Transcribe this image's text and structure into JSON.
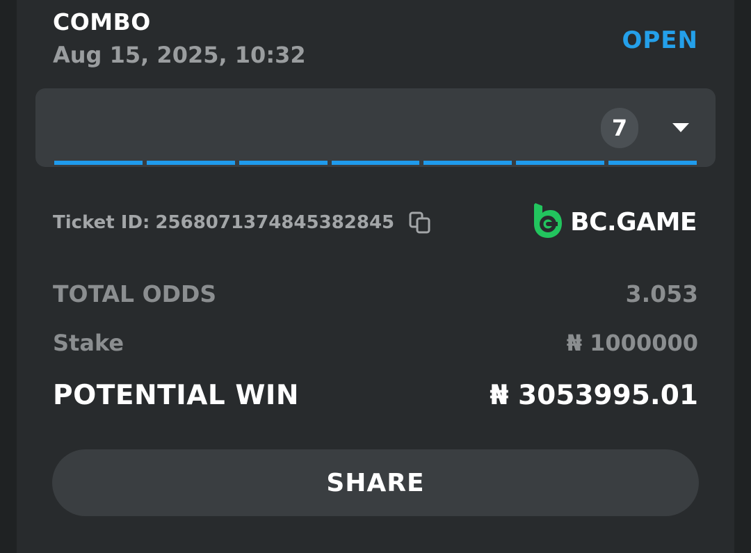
{
  "bet": {
    "type": "COMBO",
    "date": "Aug 15, 2025, 10:32",
    "status": "OPEN",
    "status_color": "#24a0ea"
  },
  "selections": {
    "count": "7",
    "expand_icon": "chevron-down-icon",
    "progress_segments": 7,
    "progress_color": "#1f9bec"
  },
  "ticket": {
    "label": "Ticket ID:",
    "id": "2568071374845382845",
    "copy_icon": "copy-icon"
  },
  "brand": {
    "name": "BC.GAME",
    "logo_color": "#22c55e"
  },
  "summary": {
    "total_odds_label": "TOTAL ODDS",
    "total_odds_value": "3.053",
    "stake_label": "Stake",
    "stake_value": "₦ 1000000",
    "potential_win_label": "POTENTIAL WIN",
    "potential_win_value": "₦ 3053995.01"
  },
  "actions": {
    "share_label": "SHARE"
  }
}
